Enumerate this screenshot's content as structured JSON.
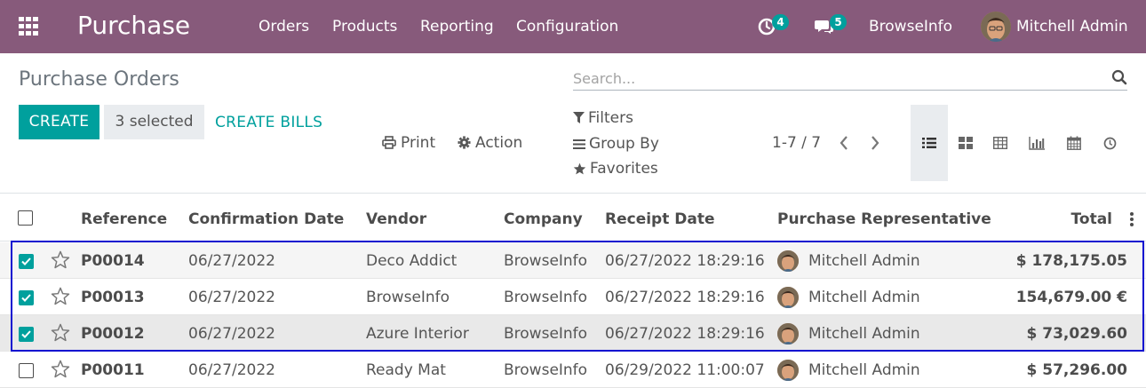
{
  "navbar": {
    "app_name": "Purchase",
    "menu": [
      "Orders",
      "Products",
      "Reporting",
      "Configuration"
    ],
    "activity_count": "4",
    "messages_count": "5",
    "company": "BrowseInfo",
    "user": "Mitchell Admin",
    "bg_color": "#875a7b"
  },
  "control_panel": {
    "title": "Purchase Orders",
    "search_placeholder": "Search...",
    "create_label": "CREATE",
    "selected_label": "3 selected",
    "create_bills_label": "CREATE BILLS",
    "print_label": "Print",
    "action_label": "Action",
    "filters_label": "Filters",
    "group_by_label": "Group By",
    "favorites_label": "Favorites",
    "pager": "1-7 / 7",
    "views": [
      "list-view-icon",
      "kanban-view-icon",
      "pivot-view-icon",
      "graph-view-icon",
      "calendar-view-icon",
      "activity-view-icon"
    ],
    "active_view": "list"
  },
  "table": {
    "columns": [
      "Reference",
      "Confirmation Date",
      "Vendor",
      "Company",
      "Receipt Date",
      "Purchase Representative",
      "Total"
    ],
    "rows": [
      {
        "reference": "P00014",
        "confirmation_date": "06/27/2022",
        "vendor": "Deco Addict",
        "company": "BrowseInfo",
        "receipt_date": "06/27/2022 18:29:16",
        "representative": "Mitchell Admin",
        "total": "$ 178,175.05",
        "checked": true
      },
      {
        "reference": "P00013",
        "confirmation_date": "06/27/2022",
        "vendor": "BrowseInfo",
        "company": "BrowseInfo",
        "receipt_date": "06/27/2022 18:29:16",
        "representative": "Mitchell Admin",
        "total": "154,679.00 €",
        "checked": true
      },
      {
        "reference": "P00012",
        "confirmation_date": "06/27/2022",
        "vendor": "Azure Interior",
        "company": "BrowseInfo",
        "receipt_date": "06/27/2022 18:29:16",
        "representative": "Mitchell Admin",
        "total": "$ 73,029.60",
        "checked": true
      },
      {
        "reference": "P00011",
        "confirmation_date": "06/27/2022",
        "vendor": "Ready Mat",
        "company": "BrowseInfo",
        "receipt_date": "06/29/2022 11:00:07",
        "representative": "Mitchell Admin",
        "total": "$ 57,296.00",
        "checked": false
      }
    ]
  },
  "colors": {
    "accent": "#00a09d",
    "highlight_border": "#1010d0"
  }
}
